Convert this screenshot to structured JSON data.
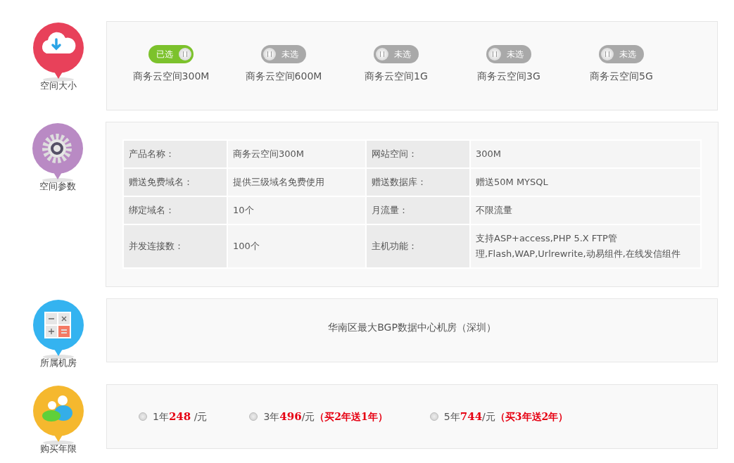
{
  "sections": [
    {
      "kind": "options",
      "label": "空间大小",
      "options": [
        {
          "badge": "已选",
          "name": "商务云空间300M",
          "selected": true
        },
        {
          "badge": "未选",
          "name": "商务云空间600M",
          "selected": false
        },
        {
          "badge": "未选",
          "name": "商务云空间1G",
          "selected": false
        },
        {
          "badge": "未选",
          "name": "商务云空间3G",
          "selected": false
        },
        {
          "badge": "未选",
          "name": "商务云空间5G",
          "selected": false
        }
      ]
    },
    {
      "kind": "table",
      "label": "空间参数",
      "rows": [
        [
          "产品名称：",
          "商务云空间300M",
          "网站空间：",
          "300M"
        ],
        [
          "赠送免费域名：",
          "提供三级域名免费使用",
          "赠送数据库：",
          "赠送50M MYSQL"
        ],
        [
          "绑定域名：",
          "10个",
          "月流量：",
          "不限流量"
        ],
        [
          "并发连接数：",
          "100个",
          "主机功能：",
          "支持ASP+access,PHP 5.X FTP管理,Flash,WAP,Urlrewrite,动易组件,在线发信组件"
        ]
      ]
    },
    {
      "kind": "text",
      "label": "所属机房",
      "text": "华南区最大BGP数据中心机房（深圳）"
    },
    {
      "kind": "radios",
      "label": "购买年限",
      "radios": [
        {
          "prefix": "1年",
          "price": "248",
          "suffix": " /元",
          "selected": false
        },
        {
          "prefix": "3年",
          "price": "496",
          "suffix": "/元",
          "promo": "（买2年送1年）",
          "selected": false
        },
        {
          "prefix": "5年",
          "price": "744",
          "suffix": "/元",
          "promo": "（买3年送2年）",
          "selected": false
        }
      ]
    }
  ]
}
